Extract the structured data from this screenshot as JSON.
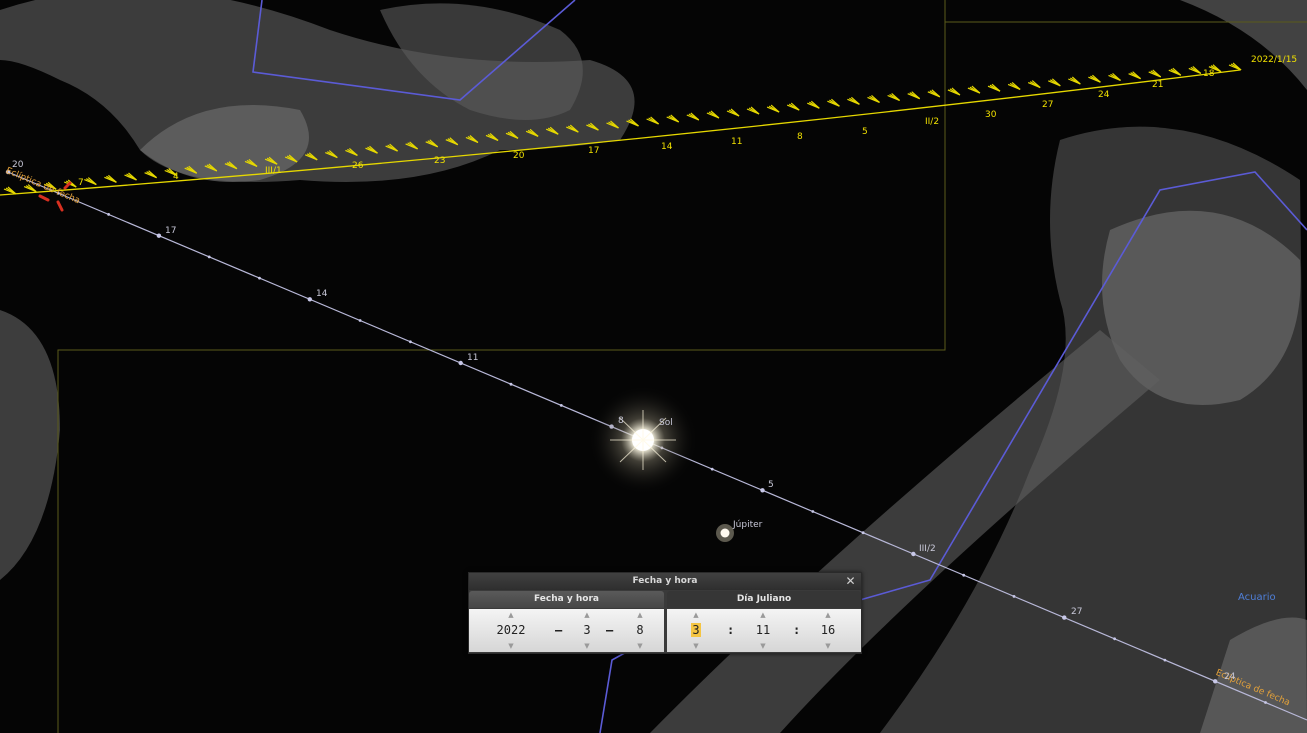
{
  "window": {
    "title": "Fecha y hora",
    "close_glyph": "✕",
    "tabs": [
      {
        "label": "Fecha y hora"
      },
      {
        "label": "Día Juliano"
      }
    ]
  },
  "date": {
    "year": "2022",
    "month": "3",
    "day": "8",
    "separator": "–"
  },
  "time": {
    "hour": "3",
    "minute": "11",
    "second": "16",
    "separator": ":"
  },
  "sky": {
    "labels": {
      "ecliptic_left": "Eclíptica de fecha",
      "ecliptic_right": "Eclíptica de fecha",
      "sun": "Sol",
      "jupiter": "Júpiter",
      "constellation": "Acuario",
      "yellow_end": "2022/1/15",
      "yellow_dates": [
        "7",
        "4",
        "III/1",
        "26",
        "23",
        "20",
        "17",
        "14",
        "11",
        "8",
        "5",
        "II/2",
        "30",
        "27",
        "24",
        "21",
        "18"
      ],
      "white_dates": [
        "20",
        "17",
        "14",
        "11",
        "8",
        "5",
        "III/2",
        "27",
        "24"
      ]
    },
    "colors": {
      "constellation_lines": "#5b5bd6",
      "boundaries": "#5a5a1a",
      "sun_path": "#b8b8d8",
      "yellow_path": "#e6d800",
      "ecliptic_label": "#e3a13a"
    }
  }
}
